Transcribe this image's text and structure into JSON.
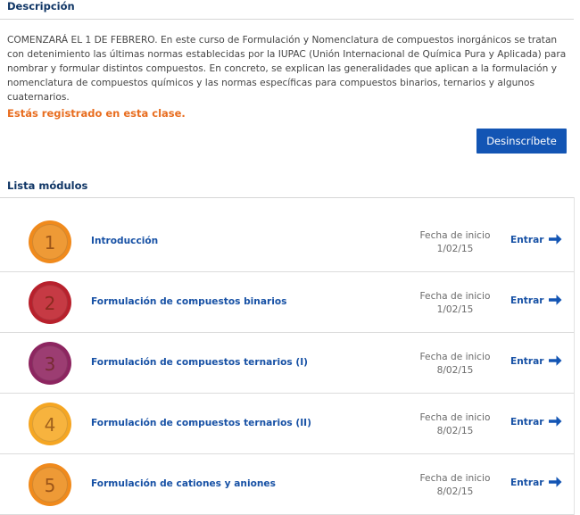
{
  "description": {
    "title": "Descripción",
    "text": "COMENZARÁ EL 1 DE FEBRERO. En este curso de Formulación y Nomenclatura de compuestos inorgánicos se tratan con detenimiento las últimas normas establecidas por la IUPAC (Unión Internacional de Química Pura y Aplicada) para nombrar y formular distintos compuestos. En concreto, se explican las generalidades que aplican a la formulación y nomenclatura de compuestos químicos y las normas específicas para compuestos binarios, ternarios y algunos cuaternarios."
  },
  "enrollment": {
    "status_text": "Estás registrado en esta clase.",
    "unsubscribe_label": "Desinscríbete"
  },
  "modules_section": {
    "title": "Lista módulos",
    "modules": [
      {
        "number": "1",
        "title": "Introducción",
        "date_label": "Fecha de inicio",
        "date": "1/02/15",
        "enter_label": "Entrar",
        "badge_color": "#f08a1c",
        "badge_inner": "#ee9a36"
      },
      {
        "number": "2",
        "title": "Formulación de compuestos binarios",
        "date_label": "Fecha de inicio",
        "date": "1/02/15",
        "enter_label": "Entrar",
        "badge_color": "#b8202c",
        "badge_inner": "#c63a44"
      },
      {
        "number": "3",
        "title": "Formulación de compuestos ternarios (I)",
        "date_label": "Fecha de inicio",
        "date": "8/02/15",
        "enter_label": "Entrar",
        "badge_color": "#8d2560",
        "badge_inner": "#9c3d72"
      },
      {
        "number": "4",
        "title": "Formulación de compuestos ternarios (II)",
        "date_label": "Fecha de inicio",
        "date": "8/02/15",
        "enter_label": "Entrar",
        "badge_color": "#f5a623",
        "badge_inner": "#f7b33e"
      },
      {
        "number": "5",
        "title": "Formulación de cationes y aniones",
        "date_label": "Fecha de inicio",
        "date": "8/02/15",
        "enter_label": "Entrar",
        "badge_color": "#f08a1c",
        "badge_inner": "#ee9a36"
      }
    ]
  },
  "icons": {
    "enter_arrow": "arrow-right-icon"
  },
  "colors": {
    "accent_blue": "#1355b4",
    "link_blue": "#1751a5",
    "heading_navy": "#0f3565",
    "registered_orange": "#e86d1f"
  }
}
